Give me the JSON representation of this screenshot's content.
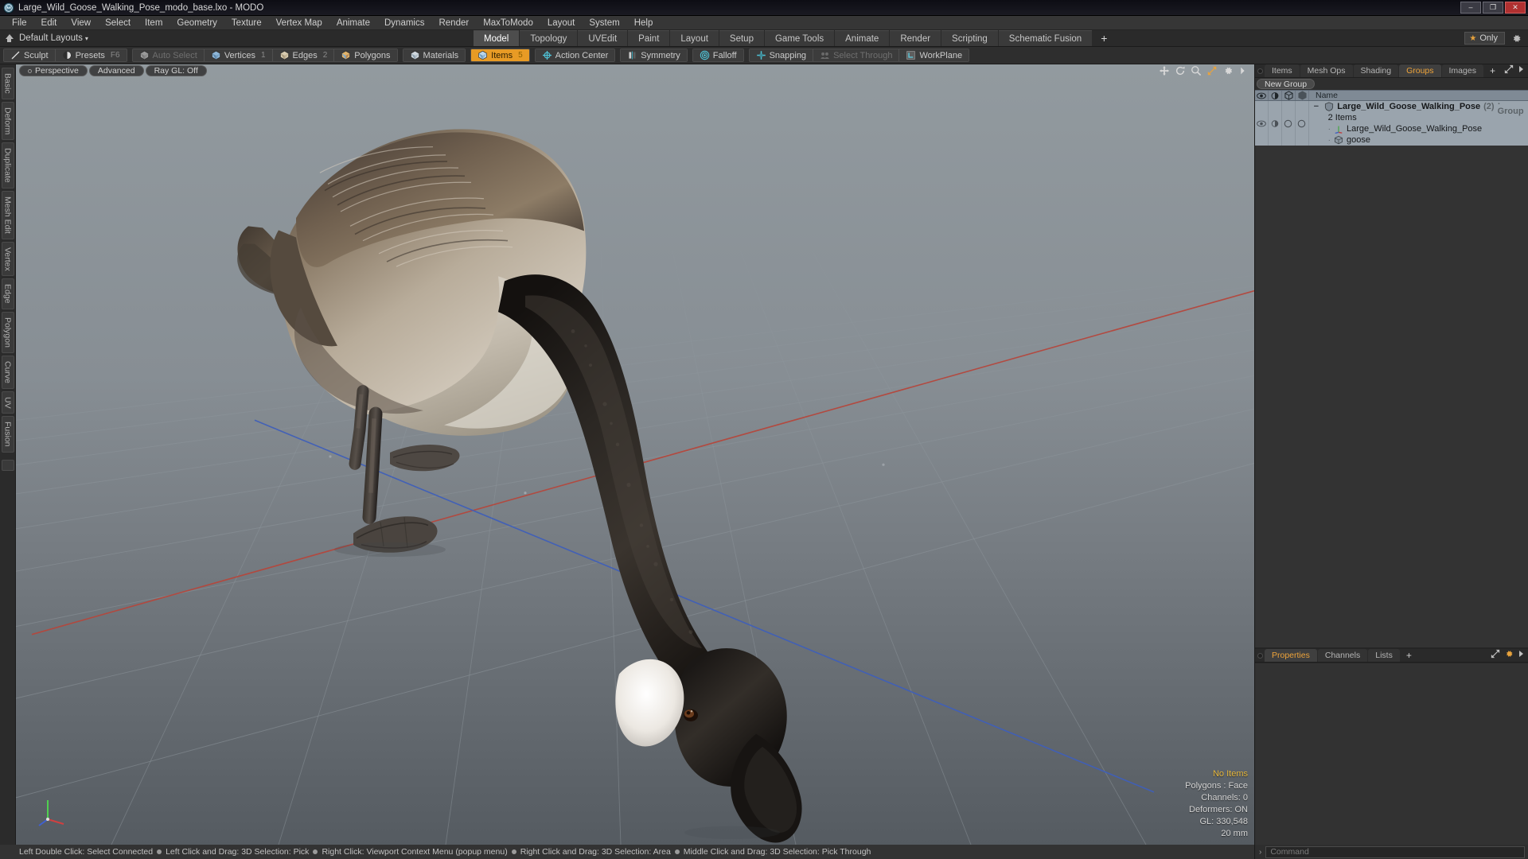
{
  "window": {
    "title": "Large_Wild_Goose_Walking_Pose_modo_base.lxo - MODO",
    "app_icon": "modo-logo-icon",
    "minimize": "–",
    "maximize": "❐",
    "close": "✕"
  },
  "menubar": {
    "items": [
      "File",
      "Edit",
      "View",
      "Select",
      "Item",
      "Geometry",
      "Texture",
      "Vertex Map",
      "Animate",
      "Dynamics",
      "Render",
      "MaxToModo",
      "Layout",
      "System",
      "Help"
    ]
  },
  "layoutbar": {
    "layout_selector": "Default Layouts",
    "caret": "▾",
    "tabs": [
      {
        "label": "Model",
        "active": true
      },
      {
        "label": "Topology",
        "active": false
      },
      {
        "label": "UVEdit",
        "active": false
      },
      {
        "label": "Paint",
        "active": false
      },
      {
        "label": "Layout",
        "active": false
      },
      {
        "label": "Setup",
        "active": false
      },
      {
        "label": "Game Tools",
        "active": false
      },
      {
        "label": "Animate",
        "active": false
      },
      {
        "label": "Render",
        "active": false
      },
      {
        "label": "Scripting",
        "active": false
      },
      {
        "label": "Schematic Fusion",
        "active": false
      }
    ],
    "add_tab": "+",
    "only_label": "Only",
    "star_glyph": "★"
  },
  "modebar": {
    "group1": [
      {
        "label": "Sculpt",
        "icon": "sculpt-brush-icon",
        "active": false,
        "dim": false,
        "hint": ""
      },
      {
        "label": "Presets",
        "icon": "presets-sphere-icon",
        "active": false,
        "dim": false,
        "hint": "F6"
      }
    ],
    "group2": [
      {
        "label": "Auto Select",
        "icon": "cube-gray-icon",
        "active": false,
        "dim": true,
        "hint": ""
      },
      {
        "label": "Vertices",
        "icon": "cube-vertices-icon",
        "active": false,
        "dim": false,
        "hint": "1"
      },
      {
        "label": "Edges",
        "icon": "cube-edges-icon",
        "active": false,
        "dim": false,
        "hint": "2"
      },
      {
        "label": "Polygons",
        "icon": "cube-polygons-icon",
        "active": false,
        "dim": false,
        "hint": ""
      }
    ],
    "group3": [
      {
        "label": "Materials",
        "icon": "cube-materials-icon",
        "active": false,
        "dim": false,
        "hint": ""
      }
    ],
    "group4": [
      {
        "label": "Items",
        "icon": "cube-items-icon",
        "active": true,
        "dim": false,
        "hint": "5"
      }
    ],
    "group5": [
      {
        "label": "Action Center",
        "icon": "action-center-icon",
        "active": false,
        "dim": false,
        "hint": ""
      }
    ],
    "group6": [
      {
        "label": "Symmetry",
        "icon": "symmetry-icon",
        "active": false,
        "dim": false,
        "hint": ""
      }
    ],
    "group7": [
      {
        "label": "Falloff",
        "icon": "falloff-icon",
        "active": false,
        "dim": false,
        "hint": ""
      }
    ],
    "group8": [
      {
        "label": "Snapping",
        "icon": "snapping-icon",
        "active": false,
        "dim": false,
        "hint": ""
      },
      {
        "label": "Select Through",
        "icon": "select-through-icon",
        "active": false,
        "dim": true,
        "hint": ""
      },
      {
        "label": "WorkPlane",
        "icon": "workplane-icon",
        "active": false,
        "dim": false,
        "hint": ""
      }
    ]
  },
  "leftrail": {
    "tabs": [
      "Basic",
      "Deform",
      "Duplicate",
      "Mesh Edit",
      "Vertex",
      "Edge",
      "Polygon",
      "Curve",
      "UV",
      "Fusion"
    ]
  },
  "viewport": {
    "pills": [
      {
        "label": "Perspective",
        "dot": true
      },
      {
        "label": "Advanced",
        "dot": false
      },
      {
        "label": "Ray GL: Off",
        "dot": false
      }
    ],
    "header_icons": [
      "move-view-icon",
      "rotate-view-icon",
      "zoom-view-icon",
      "fit-view-icon",
      "viewport-settings-gear-icon",
      "viewport-menu-arrow-icon"
    ],
    "stats": {
      "selection": "No Items",
      "polygons": "Polygons : Face",
      "channels": "Channels: 0",
      "deformers": "Deformers: ON",
      "gl": "GL: 330,548",
      "scale": "20 mm"
    },
    "axis_gizmo": "axis-gizmo-icon",
    "subject": "canada-goose-3d-model"
  },
  "rightpanel": {
    "tabs": [
      {
        "label": "Items",
        "active": false
      },
      {
        "label": "Mesh Ops",
        "active": false
      },
      {
        "label": "Shading",
        "active": false
      },
      {
        "label": "Groups",
        "active": true
      },
      {
        "label": "Images",
        "active": false
      }
    ],
    "add_tab": "+",
    "header_icons": [
      "expand-panel-icon",
      "panel-menu-arrow-icon"
    ],
    "new_group_button": "New Group",
    "tree_columns": [
      "visibility-eye-icon",
      "shading-icon",
      "render-icon",
      "wireframe-icon"
    ],
    "name_column": "Name",
    "tree": [
      {
        "name": "Large_Wild_Goose_Walking_Pose",
        "count": "(2)",
        "type": ": Group",
        "subtitle": "2 Items",
        "icon": "group-shield-icon",
        "level": 0,
        "bold": true
      },
      {
        "name": "Large_Wild_Goose_Walking_Pose",
        "icon": "locator-axis-icon",
        "level": 1,
        "bold": false
      },
      {
        "name": "goose",
        "icon": "mesh-cube-icon",
        "level": 1,
        "bold": false
      }
    ],
    "lower_tabs": [
      {
        "label": "Properties",
        "active": true
      },
      {
        "label": "Channels",
        "active": false
      },
      {
        "label": "Lists",
        "active": false
      }
    ],
    "lower_add_tab": "+",
    "lower_icons": [
      "expand-panel-icon",
      "panel-settings-gear-icon",
      "panel-menu-arrow-icon"
    ]
  },
  "statusbar": {
    "hints": [
      "Left Double Click: Select Connected",
      "Left Click and Drag: 3D Selection: Pick",
      "Right Click: Viewport Context Menu (popup menu)",
      "Right Click and Drag: 3D Selection: Area",
      "Middle Click and Drag: 3D Selection: Pick Through"
    ],
    "command_placeholder": "Command",
    "command_arrow": "›"
  },
  "colors": {
    "accent_orange": "#e89b25",
    "tab_active_orange": "#eda33a",
    "axis_x_red": "#b4473c",
    "axis_z_blue": "#3f5fb8",
    "panel_bg": "#2e2e2e",
    "tree_row_bg": "#9aa4ad"
  }
}
